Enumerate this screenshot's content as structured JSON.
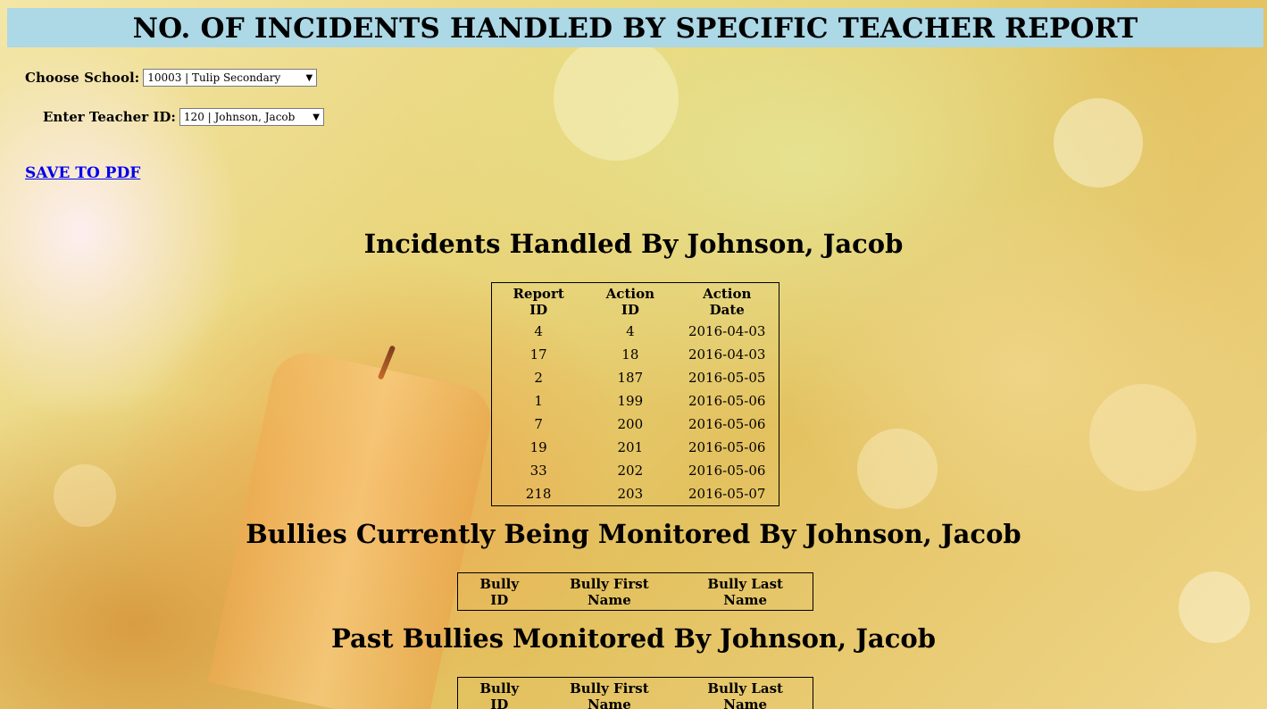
{
  "page": {
    "title": "NO. OF INCIDENTS HANDLED BY SPECIFIC TEACHER REPORT"
  },
  "filters": {
    "school_label": "Choose School:",
    "school_value": "10003 | Tulip Secondary",
    "teacher_label": "Enter Teacher ID:",
    "teacher_value": "120 | Johnson, Jacob"
  },
  "actions": {
    "save_pdf": "SAVE TO PDF"
  },
  "incidents": {
    "title": "Incidents Handled By Johnson, Jacob",
    "columns": [
      "Report ID",
      "Action ID",
      "Action Date"
    ],
    "rows": [
      [
        "4",
        "4",
        "2016-04-03"
      ],
      [
        "17",
        "18",
        "2016-04-03"
      ],
      [
        "2",
        "187",
        "2016-05-05"
      ],
      [
        "1",
        "199",
        "2016-05-06"
      ],
      [
        "7",
        "200",
        "2016-05-06"
      ],
      [
        "19",
        "201",
        "2016-05-06"
      ],
      [
        "33",
        "202",
        "2016-05-06"
      ],
      [
        "218",
        "203",
        "2016-05-07"
      ]
    ]
  },
  "current_bullies": {
    "title": "Bullies Currently Being Monitored By Johnson, Jacob",
    "columns": [
      "Bully ID",
      "Bully First Name",
      "Bully Last Name"
    ],
    "rows": []
  },
  "past_bullies": {
    "title": "Past Bullies Monitored By Johnson, Jacob",
    "columns": [
      "Bully ID",
      "Bully First Name",
      "Bully Last Name"
    ],
    "rows": []
  },
  "colors": {
    "banner": "#add8e6",
    "link": "#0000ee"
  }
}
